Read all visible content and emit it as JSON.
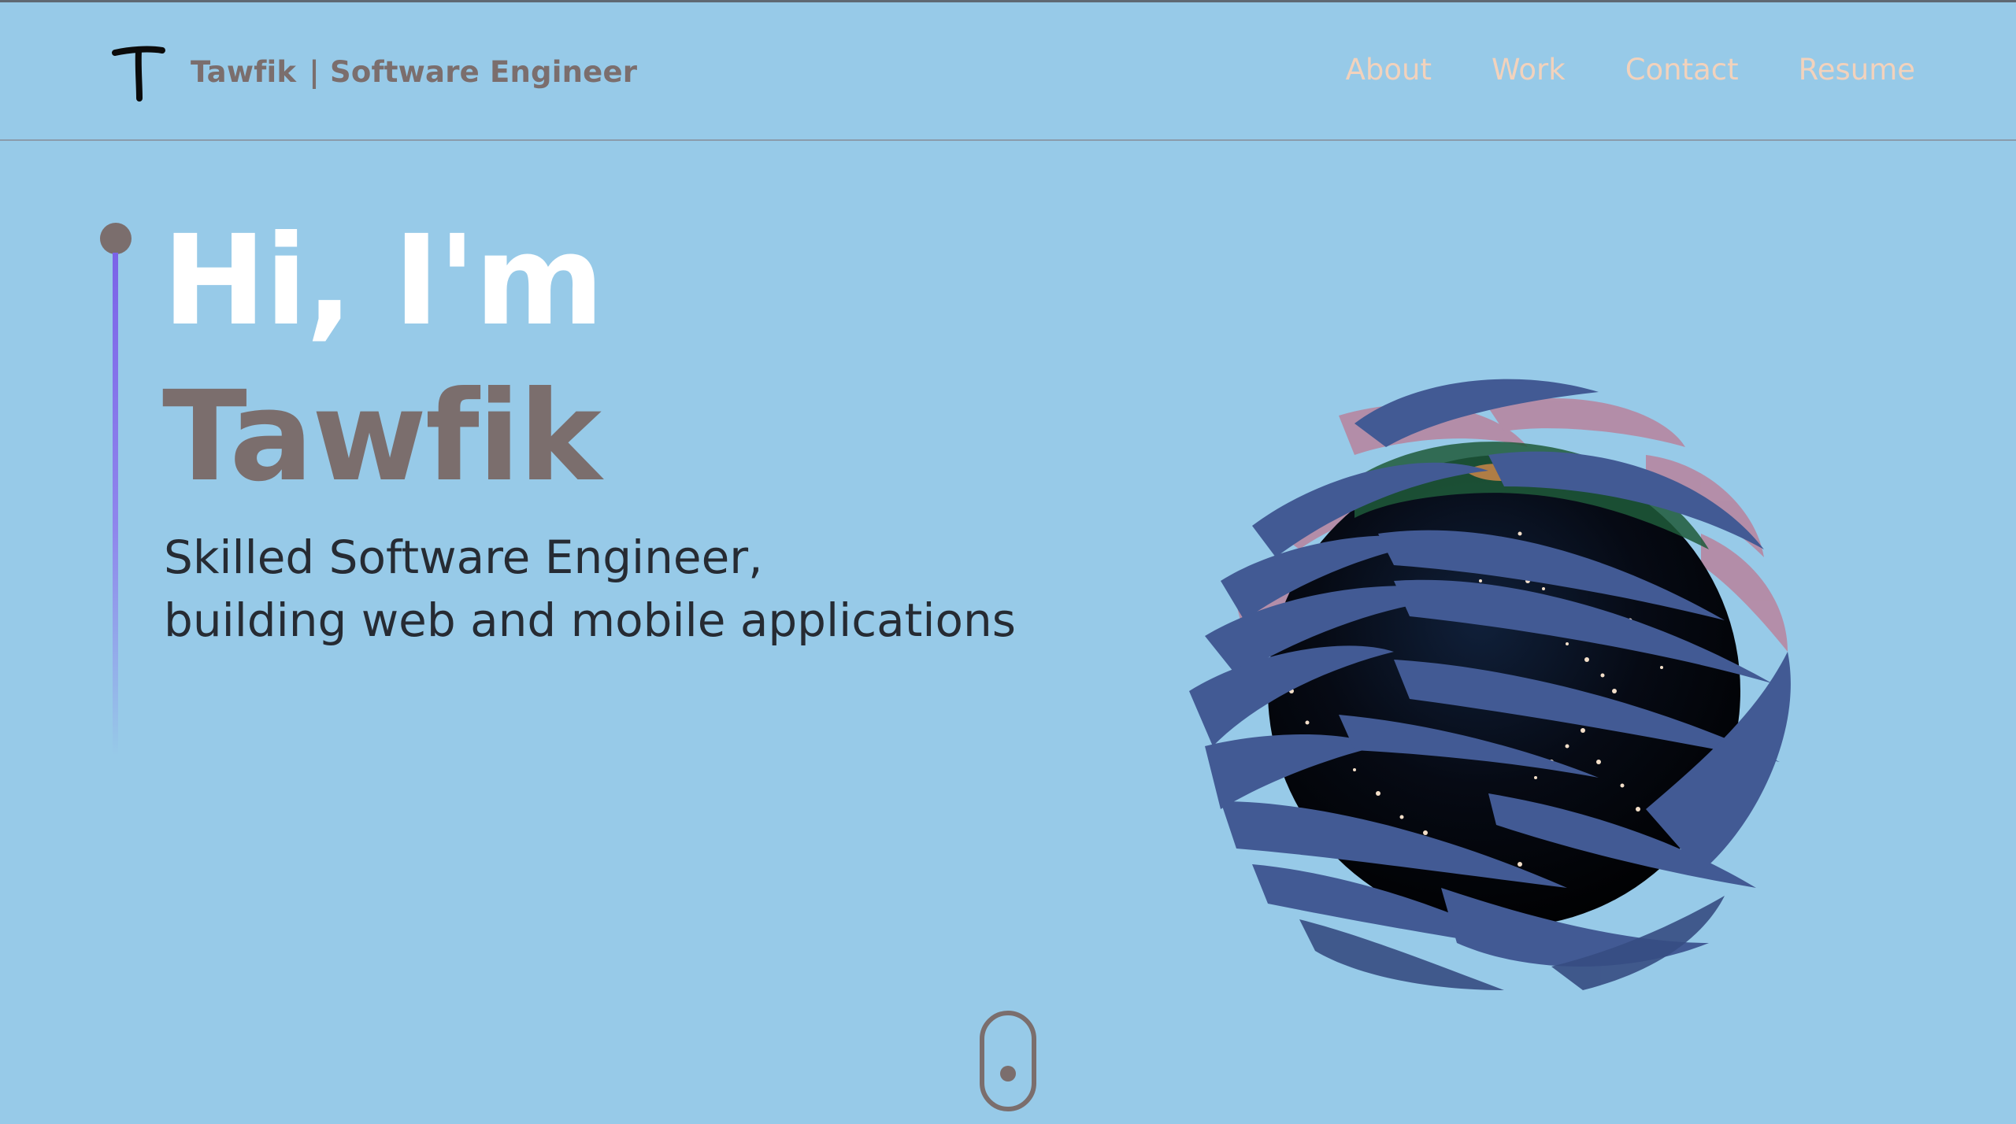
{
  "header": {
    "logo_letter": "T",
    "brand_name": "Tawfik",
    "brand_role": "| Software Engineer",
    "nav": [
      {
        "label": "About"
      },
      {
        "label": "Work"
      },
      {
        "label": "Contact"
      },
      {
        "label": "Resume"
      }
    ]
  },
  "hero": {
    "greeting": "Hi, I'm",
    "name": "Tawfik",
    "subtitle_line1": "Skilled Software Engineer,",
    "subtitle_line2": "building web and mobile applications"
  },
  "colors": {
    "background": "#97cae8",
    "accent_brown": "#7b6e6d",
    "nav_link": "#f2d2bc",
    "timeline_purple": "#7b63e8",
    "greeting_white": "#ffffff",
    "subtitle_dark": "#262b33"
  },
  "icons": {
    "logo": "letter-t-logo-icon",
    "globe": "3d-globe-icon",
    "scroll": "mouse-scroll-icon"
  }
}
